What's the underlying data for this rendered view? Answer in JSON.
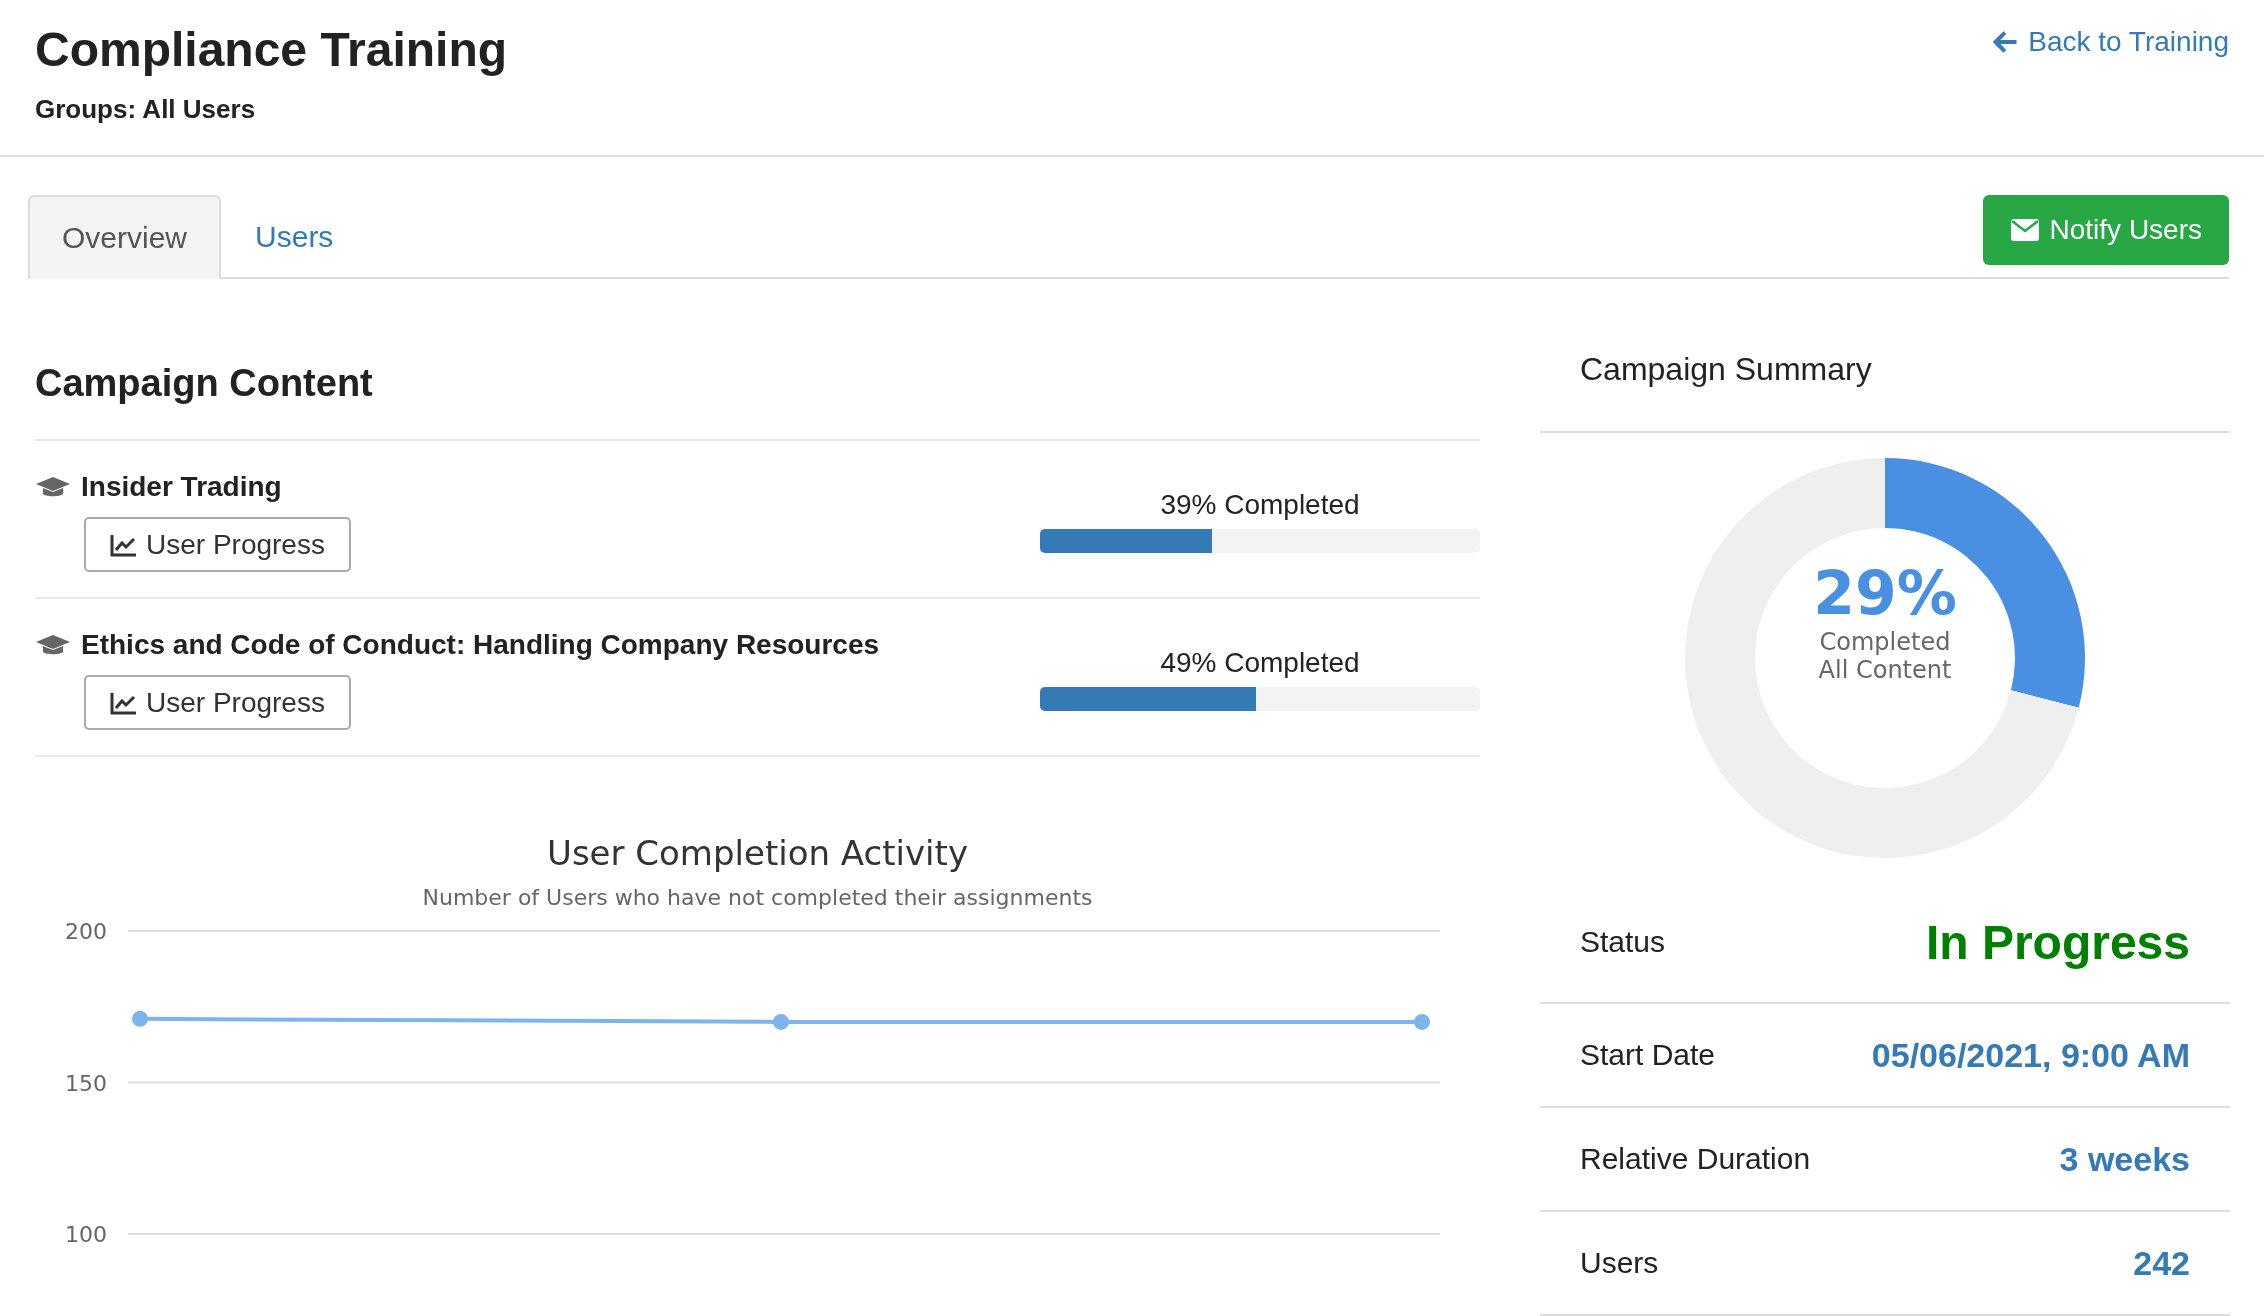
{
  "header": {
    "title": "Compliance Training",
    "subtitle": "Groups: All Users",
    "back_link": "Back to Training"
  },
  "tabs": [
    {
      "label": "Overview",
      "selected": true
    },
    {
      "label": "Users",
      "selected": false
    }
  ],
  "notify_button": "Notify Users",
  "campaign_content": {
    "heading": "Campaign Content",
    "items": [
      {
        "title": "Insider Trading",
        "button": "User Progress",
        "progress_text": "39% Completed",
        "level": 0.39
      },
      {
        "title": "Ethics and Code of Conduct: Handling Company Resources",
        "button": "User Progress",
        "progress_text": "49% Completed",
        "level": 0.49
      }
    ],
    "chart": {
      "subtitle": "Number of Users who have not completed their assignments",
      "chart_data": {
        "type": "line",
        "title": "User Completion Activity",
        "ylim": [
          100,
          200
        ],
        "yticks": [
          100,
          150,
          200
        ],
        "series": [
          {
            "color": "#7cb5ec",
            "marker": true,
            "values": [
              171,
              170,
              170
            ]
          }
        ]
      }
    }
  },
  "summary": {
    "heading": "Campaign Summary",
    "percent": "29%",
    "caption_1": "Completed",
    "caption_2": "All Content",
    "chart_data": {
      "type": "donut",
      "values": [
        29,
        71
      ]
    },
    "rows": [
      {
        "label": "Status",
        "value": "In Progress",
        "kind": "status"
      },
      {
        "label": "Start Date",
        "value": "05/06/2021, 9:00 AM",
        "kind": "info"
      },
      {
        "label": "Relative Duration",
        "value": "3 weeks",
        "kind": "info"
      },
      {
        "label": "Users",
        "value": "242",
        "kind": "info"
      }
    ]
  }
}
